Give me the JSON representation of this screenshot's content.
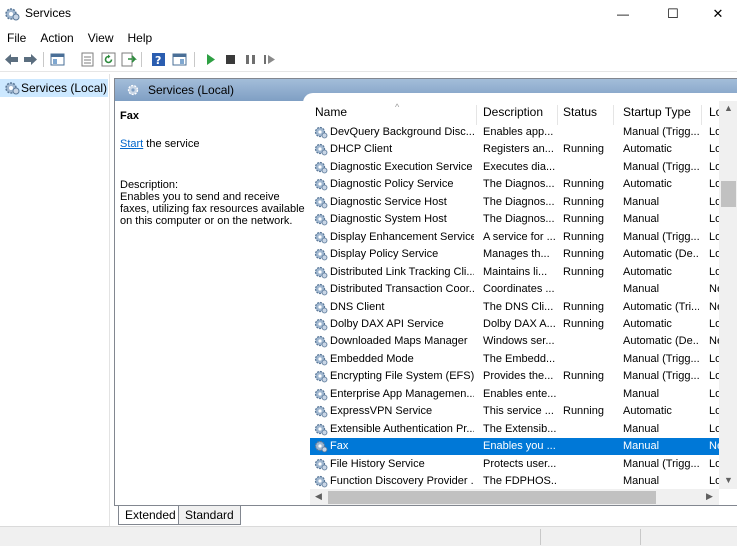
{
  "window": {
    "title": "Services",
    "controls": {
      "minimize": "—",
      "maximize": "☐",
      "close": "✕"
    }
  },
  "menu": [
    "File",
    "Action",
    "View",
    "Help"
  ],
  "toolbar": [
    "back-icon",
    "forward-icon",
    "show-hide-console-tree-icon",
    "properties-icon",
    "refresh-icon",
    "export-list-icon",
    "help-icon",
    "mmc-view-icon",
    "start-service-icon",
    "stop-service-icon",
    "pause-service-icon",
    "restart-service-icon"
  ],
  "tree": {
    "item_label": "Services (Local)"
  },
  "main": {
    "header_title": "Services (Local)",
    "selected_service": "Fax",
    "start_link": "Start",
    "start_suffix": " the service",
    "description_label": "Description:",
    "description_text": "Enables you to send and receive faxes, utilizing fax resources available on this computer or on the network."
  },
  "columns": [
    "Name",
    "Description",
    "Status",
    "Startup Type",
    "Log"
  ],
  "rows": [
    {
      "name": "DevQuery Background Disc...",
      "desc": "Enables app...",
      "status": "",
      "startup": "Manual (Trigg...",
      "log": "Loc"
    },
    {
      "name": "DHCP Client",
      "desc": "Registers an...",
      "status": "Running",
      "startup": "Automatic",
      "log": "Loc"
    },
    {
      "name": "Diagnostic Execution Service",
      "desc": "Executes dia...",
      "status": "",
      "startup": "Manual (Trigg...",
      "log": "Loc"
    },
    {
      "name": "Diagnostic Policy Service",
      "desc": "The Diagnos...",
      "status": "Running",
      "startup": "Automatic",
      "log": "Loc"
    },
    {
      "name": "Diagnostic Service Host",
      "desc": "The Diagnos...",
      "status": "Running",
      "startup": "Manual",
      "log": "Loc"
    },
    {
      "name": "Diagnostic System Host",
      "desc": "The Diagnos...",
      "status": "Running",
      "startup": "Manual",
      "log": "Loc"
    },
    {
      "name": "Display Enhancement Service",
      "desc": "A service for ...",
      "status": "Running",
      "startup": "Manual (Trigg...",
      "log": "Loc"
    },
    {
      "name": "Display Policy Service",
      "desc": "Manages th...",
      "status": "Running",
      "startup": "Automatic (De...",
      "log": "Loc"
    },
    {
      "name": "Distributed Link Tracking Cli...",
      "desc": "Maintains li...",
      "status": "Running",
      "startup": "Automatic",
      "log": "Loc"
    },
    {
      "name": "Distributed Transaction Coor...",
      "desc": "Coordinates ...",
      "status": "",
      "startup": "Manual",
      "log": "Ne"
    },
    {
      "name": "DNS Client",
      "desc": "The DNS Cli...",
      "status": "Running",
      "startup": "Automatic (Tri...",
      "log": "Ne"
    },
    {
      "name": "Dolby DAX API Service",
      "desc": "Dolby DAX A...",
      "status": "Running",
      "startup": "Automatic",
      "log": "Loc"
    },
    {
      "name": "Downloaded Maps Manager",
      "desc": "Windows ser...",
      "status": "",
      "startup": "Automatic (De...",
      "log": "Ne"
    },
    {
      "name": "Embedded Mode",
      "desc": "The Embedd...",
      "status": "",
      "startup": "Manual (Trigg...",
      "log": "Loc"
    },
    {
      "name": "Encrypting File System (EFS)",
      "desc": "Provides the...",
      "status": "Running",
      "startup": "Manual (Trigg...",
      "log": "Loc"
    },
    {
      "name": "Enterprise App Managemen...",
      "desc": "Enables ente...",
      "status": "",
      "startup": "Manual",
      "log": "Loc"
    },
    {
      "name": "ExpressVPN Service",
      "desc": "This service ...",
      "status": "Running",
      "startup": "Automatic",
      "log": "Loc"
    },
    {
      "name": "Extensible Authentication Pr...",
      "desc": "The Extensib...",
      "status": "",
      "startup": "Manual",
      "log": "Loc"
    },
    {
      "name": "Fax",
      "desc": "Enables you ...",
      "status": "",
      "startup": "Manual",
      "log": "Ne",
      "selected": true
    },
    {
      "name": "File History Service",
      "desc": "Protects user...",
      "status": "",
      "startup": "Manual (Trigg...",
      "log": "Loc"
    },
    {
      "name": "Function Discovery Provider ...",
      "desc": "The FDPHOS...",
      "status": "",
      "startup": "Manual",
      "log": "Loc"
    }
  ],
  "tabs": [
    "Extended",
    "Standard"
  ],
  "colors": {
    "selection": "#0078d7",
    "header_gradient": "#8fabd0",
    "tree_selection": "#cce8ff",
    "link": "#0066cc"
  }
}
